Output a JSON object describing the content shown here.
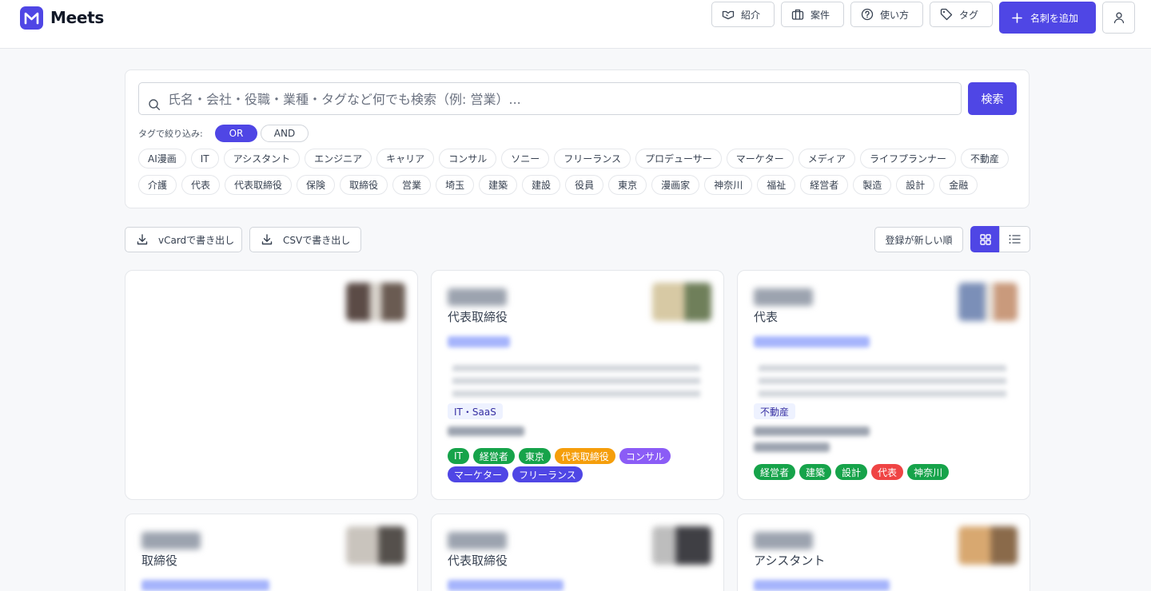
{
  "app": {
    "name": "Meets"
  },
  "nav": {
    "intro": "紹介",
    "projects": "案件",
    "howto": "使い方",
    "tags": "タグ",
    "add_card": "名刺を追加"
  },
  "search": {
    "placeholder": "氏名・会社・役職・業種・タグなど何でも検索（例: 営業）...",
    "button": "検索",
    "filter_label": "タグで絞り込み:",
    "mode_or": "OR",
    "mode_and": "AND",
    "tags_row1": [
      "AI漫画",
      "IT",
      "アシスタント",
      "エンジニア",
      "キャリア",
      "コンサル",
      "ソニー",
      "フリーランス",
      "プロデューサー",
      "マーケター",
      "メディア",
      "ライフプランナー",
      "不動産"
    ],
    "tags_row2": [
      "介護",
      "代表",
      "代表取締役",
      "保険",
      "取締役",
      "営業",
      "埼玉",
      "建築",
      "建設",
      "役員",
      "東京",
      "漫画家",
      "神奈川",
      "福祉",
      "経営者",
      "製造",
      "設計",
      "金融"
    ]
  },
  "toolbar": {
    "vcard_export": "vCardで書き出し",
    "csv_export": "CSVで書き出し",
    "sort": "登録が新しい順"
  },
  "colors": {
    "accent": "#4f46e5",
    "tag_green": "#16a34a",
    "tag_orange": "#f59e0b",
    "tag_purple": "#8b5cf6",
    "tag_indigo": "#4f46e5",
    "tag_red": "#ef4444"
  },
  "cards": [
    {
      "title": "",
      "industry": "",
      "tags": []
    },
    {
      "title": "代表取締役",
      "industry": "IT・SaaS",
      "tags": [
        {
          "label": "IT",
          "color": "#16a34a"
        },
        {
          "label": "経営者",
          "color": "#16a34a"
        },
        {
          "label": "東京",
          "color": "#16a34a"
        },
        {
          "label": "代表取締役",
          "color": "#f59e0b"
        },
        {
          "label": "コンサル",
          "color": "#8b5cf6"
        },
        {
          "label": "マーケター",
          "color": "#4f46e5"
        },
        {
          "label": "フリーランス",
          "color": "#4f46e5"
        }
      ]
    },
    {
      "title": "代表",
      "industry": "不動産",
      "tags": [
        {
          "label": "経営者",
          "color": "#16a34a"
        },
        {
          "label": "建築",
          "color": "#16a34a"
        },
        {
          "label": "設計",
          "color": "#16a34a"
        },
        {
          "label": "代表",
          "color": "#ef4444"
        },
        {
          "label": "神奈川",
          "color": "#16a34a"
        }
      ]
    },
    {
      "title": "取締役",
      "industry": "",
      "tags": []
    },
    {
      "title": "代表取締役",
      "industry": "",
      "tags": []
    },
    {
      "title": "アシスタント",
      "industry": "",
      "tags": []
    }
  ]
}
